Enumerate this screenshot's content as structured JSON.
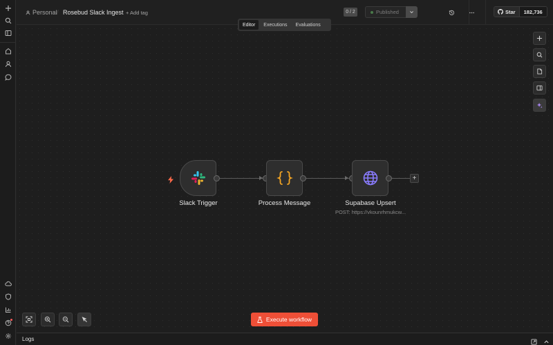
{
  "header": {
    "project": "Personal",
    "separator": "/",
    "workflow_name": "Rosebud Slack Ingest",
    "add_tag": "+ Add tag",
    "counter": "0 / 2",
    "publish_label": "Published",
    "github_star": "Star",
    "github_count": "182,736"
  },
  "tabs": [
    {
      "label": "Editor",
      "active": true
    },
    {
      "label": "Executions",
      "active": false
    },
    {
      "label": "Evaluations",
      "active": false
    }
  ],
  "nodes": [
    {
      "name": "Slack Trigger",
      "subtitle": "",
      "icon": "slack-icon"
    },
    {
      "name": "Process Message",
      "subtitle": "",
      "icon": "code-braces-icon"
    },
    {
      "name": "Supabase Upsert",
      "subtitle": "POST: https://vkounrhmukcw...",
      "icon": "globe-icon"
    }
  ],
  "execute_button": "Execute workflow",
  "logs_label": "Logs",
  "colors": {
    "accent": "#ee4f37",
    "code_icon": "#f5a623",
    "globe_icon": "#8a7cff",
    "ai_icon": "#b28cff"
  }
}
